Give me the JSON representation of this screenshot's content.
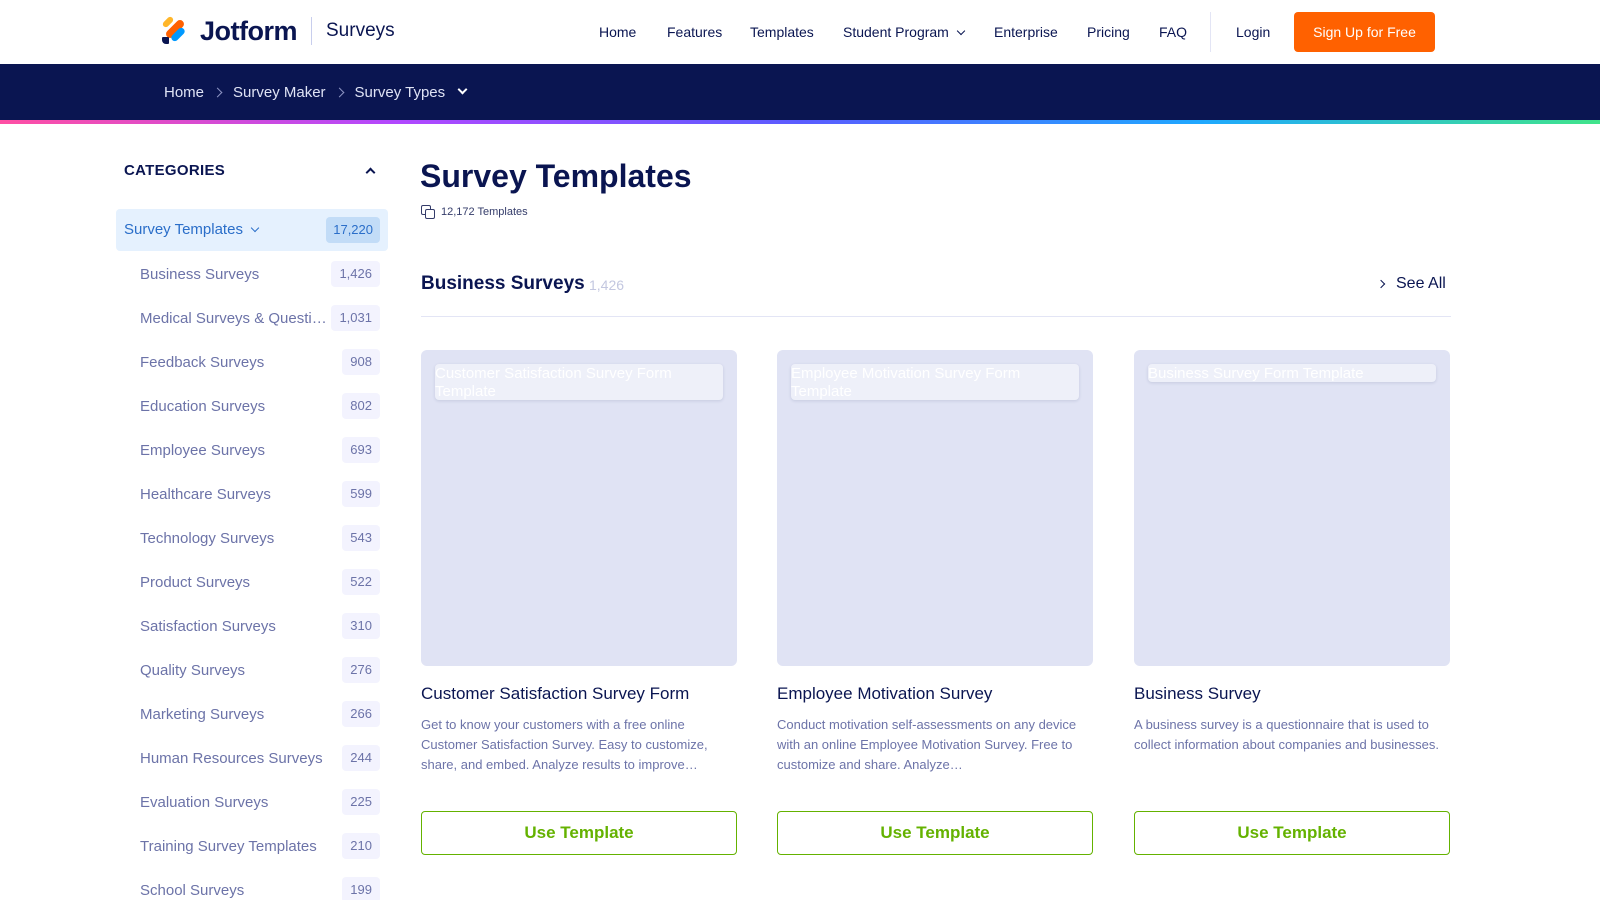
{
  "header": {
    "logo_text": "Jotform",
    "product": "Surveys",
    "nav": [
      {
        "label": "Home"
      },
      {
        "label": "Features"
      },
      {
        "label": "Templates"
      },
      {
        "label": "Student Program"
      },
      {
        "label": "Enterprise"
      },
      {
        "label": "Pricing"
      },
      {
        "label": "FAQ"
      }
    ],
    "login": "Login",
    "signup": "Sign Up for Free",
    "signup_color": "#ff6100"
  },
  "breadcrumb": {
    "items": [
      "Home",
      "Survey Maker",
      "Survey Types"
    ]
  },
  "sidebar": {
    "heading": "CATEGORIES",
    "active": {
      "label": "Survey Templates",
      "count": "17,220"
    },
    "items": [
      {
        "label": "Business Surveys",
        "count": "1,426"
      },
      {
        "label": "Medical Surveys & Questionnaires",
        "count": "1,031"
      },
      {
        "label": "Feedback Surveys",
        "count": "908"
      },
      {
        "label": "Education Surveys",
        "count": "802"
      },
      {
        "label": "Employee Surveys",
        "count": "693"
      },
      {
        "label": "Healthcare Surveys",
        "count": "599"
      },
      {
        "label": "Technology Surveys",
        "count": "543"
      },
      {
        "label": "Product Surveys",
        "count": "522"
      },
      {
        "label": "Satisfaction Surveys",
        "count": "310"
      },
      {
        "label": "Quality Surveys",
        "count": "276"
      },
      {
        "label": "Marketing Surveys",
        "count": "266"
      },
      {
        "label": "Human Resources Surveys",
        "count": "244"
      },
      {
        "label": "Evaluation Surveys",
        "count": "225"
      },
      {
        "label": "Training Survey Templates",
        "count": "210"
      },
      {
        "label": "School Surveys",
        "count": "199"
      }
    ]
  },
  "main": {
    "title": "Survey Templates",
    "template_count": "12,172 Templates",
    "section": {
      "title": "Business Surveys",
      "count": "1,426",
      "see_all": "See All"
    },
    "cards": [
      {
        "image_alt": "Customer Satisfaction Survey Form Template",
        "title": "Customer Satisfaction Survey Form",
        "description": "Get to know your customers with a free online Customer Satisfaction Survey. Easy to customize, share, and embed. Analyze results to improve…",
        "button": "Use Template"
      },
      {
        "image_alt": "Employee Motivation Survey Form Template",
        "title": "Employee Motivation Survey",
        "description": "Conduct motivation self-assessments on any device with an online Employee Motivation Survey. Free to customize and share. Analyze…",
        "button": "Use Template"
      },
      {
        "image_alt": "Business Survey Form Template",
        "title": "Business Survey",
        "description": "A business survey is a questionnaire that is used to collect information about companies and businesses.",
        "button": "Use Template"
      }
    ]
  }
}
